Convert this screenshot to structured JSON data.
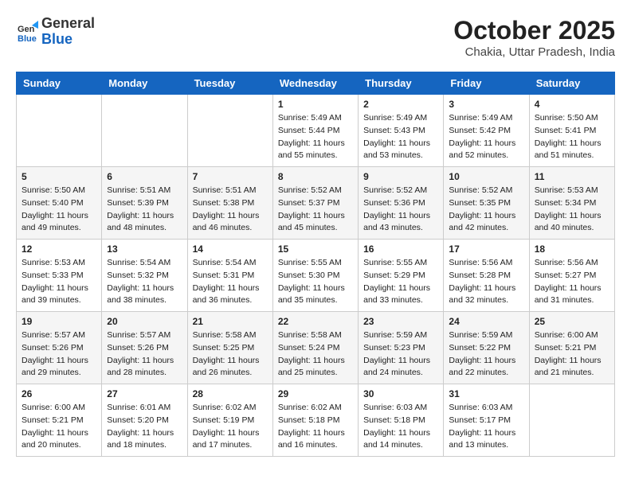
{
  "header": {
    "logo_general": "General",
    "logo_blue": "Blue",
    "month": "October 2025",
    "location": "Chakia, Uttar Pradesh, India"
  },
  "days_of_week": [
    "Sunday",
    "Monday",
    "Tuesday",
    "Wednesday",
    "Thursday",
    "Friday",
    "Saturday"
  ],
  "weeks": [
    [
      {
        "day": "",
        "info": ""
      },
      {
        "day": "",
        "info": ""
      },
      {
        "day": "",
        "info": ""
      },
      {
        "day": "1",
        "info": "Sunrise: 5:49 AM\nSunset: 5:44 PM\nDaylight: 11 hours\nand 55 minutes."
      },
      {
        "day": "2",
        "info": "Sunrise: 5:49 AM\nSunset: 5:43 PM\nDaylight: 11 hours\nand 53 minutes."
      },
      {
        "day": "3",
        "info": "Sunrise: 5:49 AM\nSunset: 5:42 PM\nDaylight: 11 hours\nand 52 minutes."
      },
      {
        "day": "4",
        "info": "Sunrise: 5:50 AM\nSunset: 5:41 PM\nDaylight: 11 hours\nand 51 minutes."
      }
    ],
    [
      {
        "day": "5",
        "info": "Sunrise: 5:50 AM\nSunset: 5:40 PM\nDaylight: 11 hours\nand 49 minutes."
      },
      {
        "day": "6",
        "info": "Sunrise: 5:51 AM\nSunset: 5:39 PM\nDaylight: 11 hours\nand 48 minutes."
      },
      {
        "day": "7",
        "info": "Sunrise: 5:51 AM\nSunset: 5:38 PM\nDaylight: 11 hours\nand 46 minutes."
      },
      {
        "day": "8",
        "info": "Sunrise: 5:52 AM\nSunset: 5:37 PM\nDaylight: 11 hours\nand 45 minutes."
      },
      {
        "day": "9",
        "info": "Sunrise: 5:52 AM\nSunset: 5:36 PM\nDaylight: 11 hours\nand 43 minutes."
      },
      {
        "day": "10",
        "info": "Sunrise: 5:52 AM\nSunset: 5:35 PM\nDaylight: 11 hours\nand 42 minutes."
      },
      {
        "day": "11",
        "info": "Sunrise: 5:53 AM\nSunset: 5:34 PM\nDaylight: 11 hours\nand 40 minutes."
      }
    ],
    [
      {
        "day": "12",
        "info": "Sunrise: 5:53 AM\nSunset: 5:33 PM\nDaylight: 11 hours\nand 39 minutes."
      },
      {
        "day": "13",
        "info": "Sunrise: 5:54 AM\nSunset: 5:32 PM\nDaylight: 11 hours\nand 38 minutes."
      },
      {
        "day": "14",
        "info": "Sunrise: 5:54 AM\nSunset: 5:31 PM\nDaylight: 11 hours\nand 36 minutes."
      },
      {
        "day": "15",
        "info": "Sunrise: 5:55 AM\nSunset: 5:30 PM\nDaylight: 11 hours\nand 35 minutes."
      },
      {
        "day": "16",
        "info": "Sunrise: 5:55 AM\nSunset: 5:29 PM\nDaylight: 11 hours\nand 33 minutes."
      },
      {
        "day": "17",
        "info": "Sunrise: 5:56 AM\nSunset: 5:28 PM\nDaylight: 11 hours\nand 32 minutes."
      },
      {
        "day": "18",
        "info": "Sunrise: 5:56 AM\nSunset: 5:27 PM\nDaylight: 11 hours\nand 31 minutes."
      }
    ],
    [
      {
        "day": "19",
        "info": "Sunrise: 5:57 AM\nSunset: 5:26 PM\nDaylight: 11 hours\nand 29 minutes."
      },
      {
        "day": "20",
        "info": "Sunrise: 5:57 AM\nSunset: 5:26 PM\nDaylight: 11 hours\nand 28 minutes."
      },
      {
        "day": "21",
        "info": "Sunrise: 5:58 AM\nSunset: 5:25 PM\nDaylight: 11 hours\nand 26 minutes."
      },
      {
        "day": "22",
        "info": "Sunrise: 5:58 AM\nSunset: 5:24 PM\nDaylight: 11 hours\nand 25 minutes."
      },
      {
        "day": "23",
        "info": "Sunrise: 5:59 AM\nSunset: 5:23 PM\nDaylight: 11 hours\nand 24 minutes."
      },
      {
        "day": "24",
        "info": "Sunrise: 5:59 AM\nSunset: 5:22 PM\nDaylight: 11 hours\nand 22 minutes."
      },
      {
        "day": "25",
        "info": "Sunrise: 6:00 AM\nSunset: 5:21 PM\nDaylight: 11 hours\nand 21 minutes."
      }
    ],
    [
      {
        "day": "26",
        "info": "Sunrise: 6:00 AM\nSunset: 5:21 PM\nDaylight: 11 hours\nand 20 minutes."
      },
      {
        "day": "27",
        "info": "Sunrise: 6:01 AM\nSunset: 5:20 PM\nDaylight: 11 hours\nand 18 minutes."
      },
      {
        "day": "28",
        "info": "Sunrise: 6:02 AM\nSunset: 5:19 PM\nDaylight: 11 hours\nand 17 minutes."
      },
      {
        "day": "29",
        "info": "Sunrise: 6:02 AM\nSunset: 5:18 PM\nDaylight: 11 hours\nand 16 minutes."
      },
      {
        "day": "30",
        "info": "Sunrise: 6:03 AM\nSunset: 5:18 PM\nDaylight: 11 hours\nand 14 minutes."
      },
      {
        "day": "31",
        "info": "Sunrise: 6:03 AM\nSunset: 5:17 PM\nDaylight: 11 hours\nand 13 minutes."
      },
      {
        "day": "",
        "info": ""
      }
    ]
  ]
}
